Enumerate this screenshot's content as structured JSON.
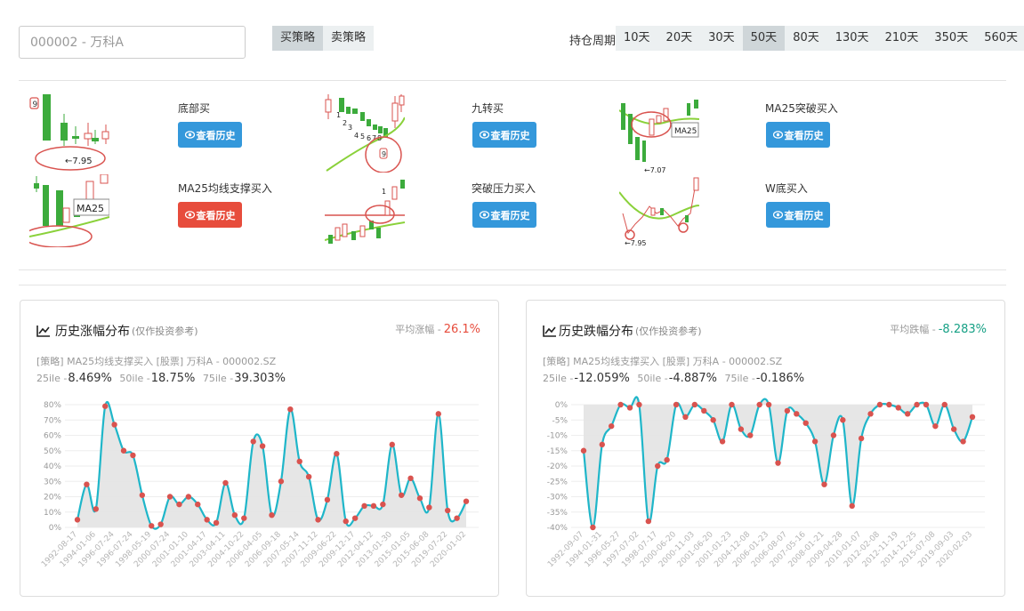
{
  "search": {
    "placeholder": "000002 - 万科A"
  },
  "strategy_type": {
    "buy": "买策略",
    "sell": "卖策略",
    "active": "buy"
  },
  "holding": {
    "label": "持仓周期",
    "options": [
      "10天",
      "20天",
      "30天",
      "50天",
      "80天",
      "130天",
      "210天",
      "350天",
      "560天"
    ],
    "active": "50天"
  },
  "strategies": [
    {
      "name": "底部买",
      "button": "查看历史",
      "button_color": "#3498db",
      "thumb_labels": [
        "9",
        "←7.95"
      ]
    },
    {
      "name": "九转买",
      "button": "查看历史",
      "button_color": "#3498db",
      "thumb_labels": [
        "1",
        "2",
        "3",
        "4",
        "5",
        "6",
        "7",
        "8",
        "9"
      ]
    },
    {
      "name": "MA25突破买入",
      "button": "查看历史",
      "button_color": "#3498db",
      "thumb_labels": [
        "MA25",
        "←7.07"
      ]
    },
    {
      "name": "MA25均线支撑买入",
      "button": "查看历史",
      "button_color": "#e74c3c",
      "thumb_labels": [
        "MA25"
      ]
    },
    {
      "name": "突破压力买入",
      "button": "查看历史",
      "button_color": "#3498db",
      "thumb_labels": [
        "1"
      ]
    },
    {
      "name": "W底买入",
      "button": "查看历史",
      "button_color": "#3498db",
      "thumb_labels": [
        "←7.95"
      ]
    }
  ],
  "rise_panel": {
    "title": "历史涨幅分布",
    "subtitle": "(仅作投资参考)",
    "avg_label": "平均涨幅 -",
    "avg_value": "26.1%",
    "meta": "[策略] MA25均线支撑买入  [股票] 万科A - 000002.SZ",
    "p25_label": "25ile -",
    "p25": "8.469%",
    "p50_label": "50ile -",
    "p50": "18.75%",
    "p75_label": "75ile -",
    "p75": "39.303%"
  },
  "fall_panel": {
    "title": "历史跌幅分布",
    "subtitle": "(仅作投资参考)",
    "avg_label": "平均跌幅 -",
    "avg_value": "-8.283%",
    "meta": "[策略] MA25均线支撑买入  [股票] 万科A - 000002.SZ",
    "p25_label": "25ile -",
    "p25": "-12.059%",
    "p50_label": "50ile -",
    "p50": "-4.887%",
    "p75_label": "75ile -",
    "p75": "-0.186%"
  },
  "colors": {
    "line": "#1fb6c9",
    "point": "#d9534f",
    "area": "#e3e3e3",
    "up": "#e74c3c",
    "down": "#16a085",
    "button_blue": "#3498db",
    "button_red": "#e74c3c"
  },
  "chart_data": [
    {
      "type": "area",
      "ylim": [
        0,
        80
      ],
      "y_ticks": [
        "0%",
        "10%",
        "20%",
        "30%",
        "40%",
        "50%",
        "60%",
        "70%",
        "80%"
      ],
      "x_tick_labels": [
        "1992-08-17",
        "1994-01-06",
        "1996-07-24",
        "1996-07-24",
        "1998-05-19",
        "2000-07-24",
        "2001-01-10",
        "2001-04-17",
        "2003-04-11",
        "2004-10-22",
        "2006-04-05",
        "2006-09-18",
        "2007-05-14",
        "2007-11-12",
        "2009-06-22",
        "2009-12-17",
        "2012-04-12",
        "2013-01-30",
        "2015-01-05",
        "2015-06-08",
        "2019-07-22",
        "2020-01-02"
      ],
      "values": [
        5,
        28,
        12,
        79,
        67,
        50,
        47,
        21,
        1,
        2,
        20,
        15,
        20,
        15,
        5,
        3,
        29,
        8,
        6,
        56,
        53,
        8,
        30,
        77,
        43,
        33,
        5,
        18,
        48,
        4,
        6,
        14,
        14,
        15,
        54,
        21,
        32,
        19,
        13,
        74,
        11,
        6,
        17
      ]
    },
    {
      "type": "area",
      "ylim": [
        -40,
        0
      ],
      "y_ticks": [
        "0%",
        "-5%",
        "-10%",
        "-15%",
        "-20%",
        "-25%",
        "-30%",
        "-35%",
        "-40%"
      ],
      "x_tick_labels": [
        "1992-09-07",
        "1994-01-31",
        "1996-05-27",
        "1997-07-02",
        "1998-07-17",
        "2000-06-20",
        "2000-11-03",
        "2001-06-20",
        "2001-01-23",
        "2004-12-08",
        "2006-01-23",
        "2006-08-07",
        "2007-05-16",
        "2008-01-21",
        "2009-04-28",
        "2010-01-07",
        "2012-02-08",
        "2012-11-19",
        "2014-12-25",
        "2015-07-08",
        "2019-09-03",
        "2020-02-03"
      ],
      "values": [
        -15,
        -40,
        -13,
        -7,
        0,
        -1,
        0,
        -38,
        -20,
        -18,
        0,
        -4,
        0,
        -2,
        -5,
        -12,
        0,
        -8,
        -10,
        0,
        0,
        -19,
        -2,
        -3,
        -6,
        -12,
        -26,
        -10,
        -5,
        -33,
        -11,
        -3,
        0,
        0,
        -1,
        -3,
        0,
        0,
        -7,
        0,
        -8,
        -12,
        -4
      ]
    }
  ]
}
